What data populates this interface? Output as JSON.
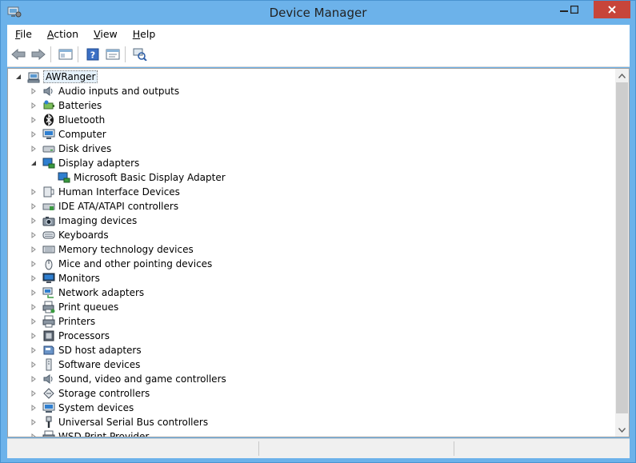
{
  "window": {
    "title": "Device Manager"
  },
  "menu": [
    {
      "accel": "F",
      "rest": "ile"
    },
    {
      "accel": "A",
      "rest": "ction"
    },
    {
      "accel": "V",
      "rest": "iew"
    },
    {
      "accel": "H",
      "rest": "elp"
    }
  ],
  "toolbar": [
    "back-icon",
    "forward-icon",
    "properties-pane-icon",
    "help-icon",
    "update-driver-icon",
    "scan-hardware-icon"
  ],
  "tree": {
    "root": "AWRanger",
    "items": [
      {
        "label": "Audio inputs and outputs",
        "icon": "speaker-icon",
        "expanded": false
      },
      {
        "label": "Batteries",
        "icon": "battery-icon",
        "expanded": false
      },
      {
        "label": "Bluetooth",
        "icon": "bluetooth-icon",
        "expanded": false
      },
      {
        "label": "Computer",
        "icon": "computer-icon",
        "expanded": false
      },
      {
        "label": "Disk drives",
        "icon": "disk-drive-icon",
        "expanded": false
      },
      {
        "label": "Display adapters",
        "icon": "display-adapter-icon",
        "expanded": true,
        "children": [
          {
            "label": "Microsoft Basic Display Adapter",
            "icon": "display-adapter-icon"
          }
        ]
      },
      {
        "label": "Human Interface Devices",
        "icon": "hid-icon",
        "expanded": false
      },
      {
        "label": "IDE ATA/ATAPI controllers",
        "icon": "ide-controller-icon",
        "expanded": false
      },
      {
        "label": "Imaging devices",
        "icon": "camera-icon",
        "expanded": false
      },
      {
        "label": "Keyboards",
        "icon": "keyboard-icon",
        "expanded": false
      },
      {
        "label": "Memory technology devices",
        "icon": "memory-icon",
        "expanded": false
      },
      {
        "label": "Mice and other pointing devices",
        "icon": "mouse-icon",
        "expanded": false
      },
      {
        "label": "Monitors",
        "icon": "monitor-icon",
        "expanded": false
      },
      {
        "label": "Network adapters",
        "icon": "network-icon",
        "expanded": false
      },
      {
        "label": "Print queues",
        "icon": "print-queue-icon",
        "expanded": false
      },
      {
        "label": "Printers",
        "icon": "printer-icon",
        "expanded": false
      },
      {
        "label": "Processors",
        "icon": "processor-icon",
        "expanded": false
      },
      {
        "label": "SD host adapters",
        "icon": "sd-card-icon",
        "expanded": false
      },
      {
        "label": "Software devices",
        "icon": "software-device-icon",
        "expanded": false
      },
      {
        "label": "Sound, video and game controllers",
        "icon": "speaker-icon",
        "expanded": false
      },
      {
        "label": "Storage controllers",
        "icon": "storage-controller-icon",
        "expanded": false
      },
      {
        "label": "System devices",
        "icon": "system-device-icon",
        "expanded": false
      },
      {
        "label": "Universal Serial Bus controllers",
        "icon": "usb-icon",
        "expanded": false
      },
      {
        "label": "WSD Print Provider",
        "icon": "printer-icon",
        "expanded": false
      }
    ]
  },
  "colors": {
    "frame": "#6cb2ea",
    "close": "#c7453a",
    "selection": "#e5f1fb"
  }
}
